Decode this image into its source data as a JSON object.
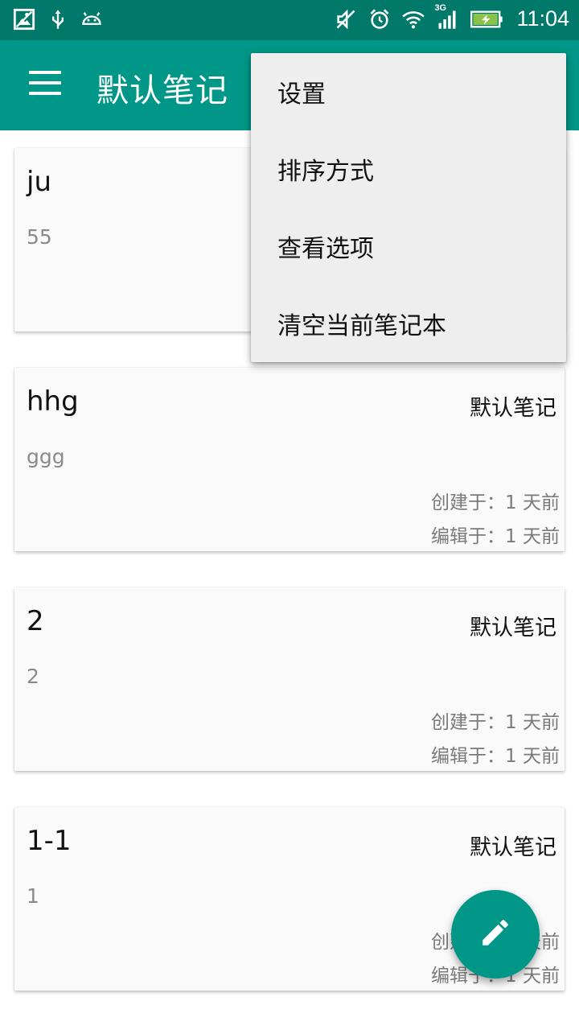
{
  "status_bar": {
    "time": "11:04",
    "network_tag": "3G",
    "icons": [
      "image-icon",
      "usb-icon",
      "android-icon",
      "mute-icon",
      "alarm-icon",
      "wifi-icon",
      "signal-icon",
      "battery-charging-icon"
    ]
  },
  "app_bar": {
    "title": "默认笔记",
    "menu_icon": "hamburger-menu-icon"
  },
  "overflow_menu": {
    "items": [
      {
        "label": "设置"
      },
      {
        "label": "排序方式"
      },
      {
        "label": "查看选项"
      },
      {
        "label": "清空当前笔记本"
      }
    ]
  },
  "notes": [
    {
      "title": "ju",
      "content": "55",
      "notebook": "",
      "created": "",
      "edited": ""
    },
    {
      "title": "hhg",
      "content": "ggg",
      "notebook": "默认笔记",
      "created": "创建于：1 天前",
      "edited": "编辑于：1 天前"
    },
    {
      "title": "2",
      "content": "2",
      "notebook": "默认笔记",
      "created": "创建于：1 天前",
      "edited": "编辑于：1 天前"
    },
    {
      "title": "1-1",
      "content": "1",
      "notebook": "默认笔记",
      "created": "创建于：1 天前",
      "edited": "编辑于：1 天前"
    }
  ],
  "fab": {
    "icon": "pencil-icon"
  },
  "colors": {
    "primary": "#009688",
    "primary_dark": "#00796b",
    "menu_background": "#eeeeee",
    "card_background": "#fafafa"
  }
}
